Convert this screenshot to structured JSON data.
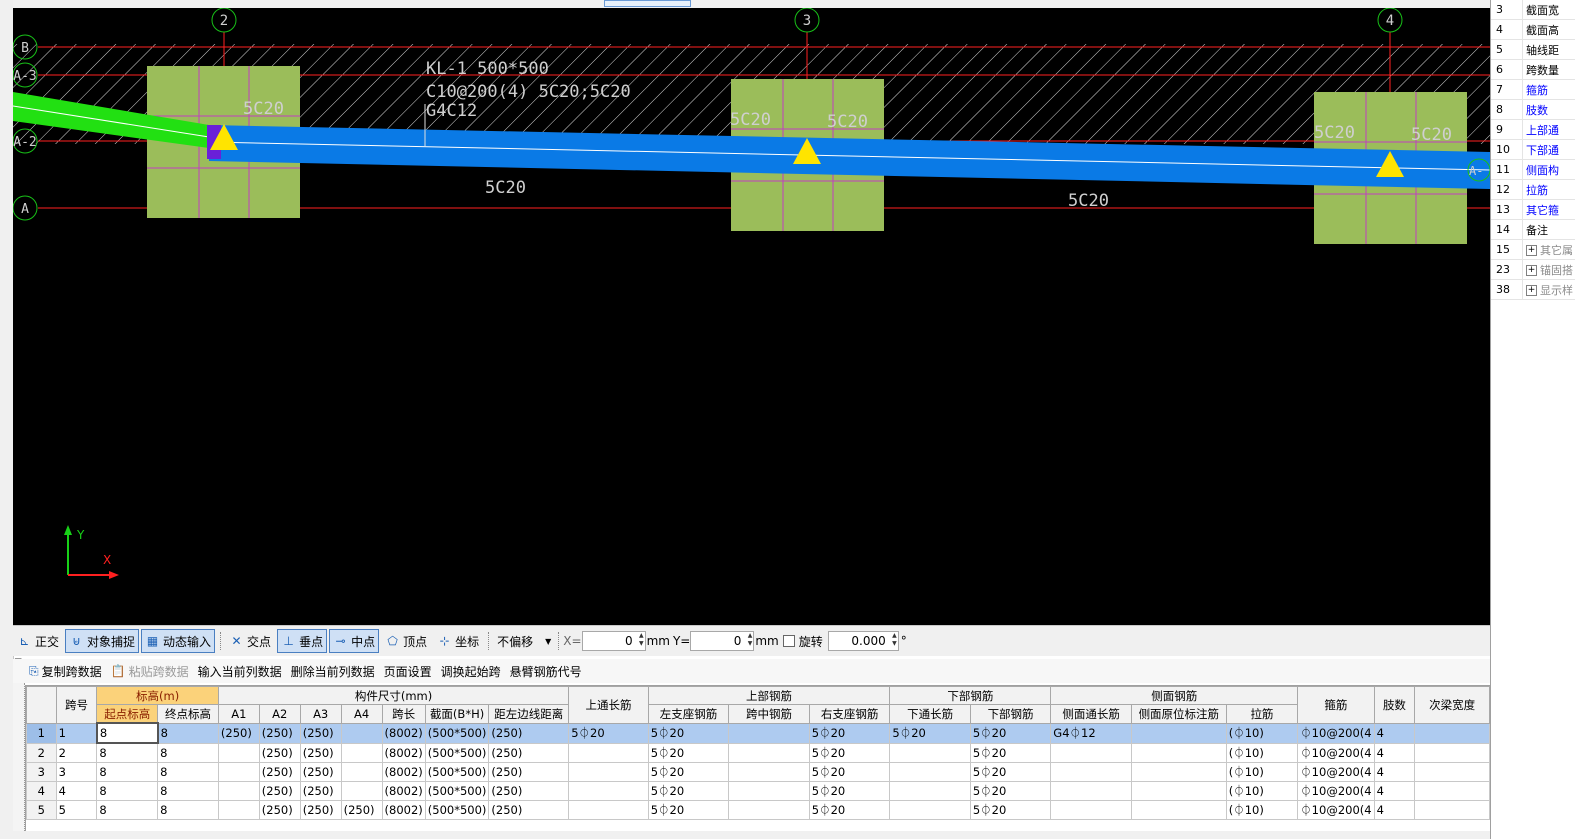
{
  "canvas": {
    "beam_label": [
      "KL-1 500*500",
      "C10@200(4) 5C20;5C20",
      "G4C12"
    ],
    "col_marks": {
      "col2": "5C20",
      "col3_left": "5C20",
      "col3_right": "5C20",
      "col4_left": "5C20",
      "col4_right": "5C20"
    },
    "span_marks": [
      "5C20",
      "5C20"
    ],
    "axis_top": [
      "2",
      "3",
      "4"
    ],
    "axis_left": [
      "B",
      "A-3",
      "A-2",
      "A"
    ],
    "axis_right_partial": "A-",
    "ucs_y": "Y",
    "ucs_x": "X",
    "colors": {
      "blue_beam": "#0a7ae6",
      "green_beam": "#22e012",
      "column": "#9bbd5a",
      "grid_line": "#ff2020",
      "axis_circle": "#18c018",
      "support_triangle": "#ffe400"
    }
  },
  "right_panel": {
    "rows": [
      {
        "num": "3",
        "label": "截面宽",
        "style": "normal"
      },
      {
        "num": "4",
        "label": "截面高",
        "style": "normal"
      },
      {
        "num": "5",
        "label": "轴线距",
        "style": "normal"
      },
      {
        "num": "6",
        "label": "跨数量",
        "style": "normal"
      },
      {
        "num": "7",
        "label": "箍筋",
        "style": "blue"
      },
      {
        "num": "8",
        "label": "肢数",
        "style": "blue"
      },
      {
        "num": "9",
        "label": "上部通",
        "style": "blue"
      },
      {
        "num": "10",
        "label": "下部通",
        "style": "blue"
      },
      {
        "num": "11",
        "label": "侧面构",
        "style": "blue"
      },
      {
        "num": "12",
        "label": "拉筋",
        "style": "blue"
      },
      {
        "num": "13",
        "label": "其它箍",
        "style": "blue"
      },
      {
        "num": "14",
        "label": "备注",
        "style": "normal"
      },
      {
        "num": "15",
        "label": "其它属",
        "style": "gray",
        "plus": "+"
      },
      {
        "num": "23",
        "label": "锚固搭",
        "style": "gray",
        "plus": "+"
      },
      {
        "num": "38",
        "label": "显示样",
        "style": "gray",
        "plus": "+"
      }
    ]
  },
  "snapbar": {
    "ortho": "正交",
    "snap": "对象捕捉",
    "dyn_input": "动态输入",
    "intersection": "交点",
    "perpendicular": "垂点",
    "midpoint": "中点",
    "vertex": "顶点",
    "coordinate": "坐标",
    "offset_mode": "不偏移",
    "x_label": "X=",
    "x_value": "0",
    "x_unit": "mm",
    "y_label": "Y=",
    "y_value": "0",
    "y_unit": "mm",
    "rotate_label": "旋转",
    "rotate_value": "0.000",
    "degree": "°"
  },
  "toolbar2": {
    "copy_span": "复制跨数据",
    "paste_span": "粘贴跨数据",
    "input_col": "输入当前列数据",
    "delete_col": "删除当前列数据",
    "page_setup": "页面设置",
    "swap_start": "调换起始跨",
    "cantilever": "悬臂钢筋代号"
  },
  "grid": {
    "headers": {
      "span_no": "跨号",
      "elevation": "标高(m)",
      "start_elev": "起点标高",
      "end_elev": "终点标高",
      "dims": "构件尺寸(mm)",
      "a1": "A1",
      "a2": "A2",
      "a3": "A3",
      "a4": "A4",
      "span_len": "跨长",
      "section": "截面(B*H)",
      "edge_dist": "距左边线距离",
      "top_through": "上通长筋",
      "top_rebar": "上部钢筋",
      "left_support": "左支座钢筋",
      "mid_span": "跨中钢筋",
      "right_support": "右支座钢筋",
      "bottom_rebar": "下部钢筋",
      "bottom_through": "下通长筋",
      "bottom_steel": "下部钢筋",
      "side_rebar": "侧面钢筋",
      "side_through": "侧面通长筋",
      "side_original": "侧面原位标注筋",
      "tie": "拉筋",
      "stirrup": "箍筋",
      "legs": "肢数",
      "secondary_width": "次梁宽度"
    },
    "rows": [
      {
        "rn": "1",
        "span": "1",
        "start": "8",
        "end": "8",
        "a1": "(250)",
        "a2": "(250)",
        "a3": "(250)",
        "a4": "",
        "len": "(8002)",
        "sec": "(500*500)",
        "edge": "(250)",
        "top_through": "5⏀20",
        "left": "5⏀20",
        "mid": "",
        "right": "5⏀20",
        "bot_through": "5⏀20",
        "bot": "5⏀20",
        "side_through": "G4⏀12",
        "side_orig": "",
        "tie": "(⏀10)",
        "stirrup": "⏀10@200(4",
        "legs": "4",
        "sec_width": ""
      },
      {
        "rn": "2",
        "span": "2",
        "start": "8",
        "end": "8",
        "a1": "",
        "a2": "(250)",
        "a3": "(250)",
        "a4": "",
        "len": "(8002)",
        "sec": "(500*500)",
        "edge": "(250)",
        "top_through": "",
        "left": "5⏀20",
        "mid": "",
        "right": "5⏀20",
        "bot_through": "",
        "bot": "5⏀20",
        "side_through": "",
        "side_orig": "",
        "tie": "(⏀10)",
        "stirrup": "⏀10@200(4",
        "legs": "4",
        "sec_width": ""
      },
      {
        "rn": "3",
        "span": "3",
        "start": "8",
        "end": "8",
        "a1": "",
        "a2": "(250)",
        "a3": "(250)",
        "a4": "",
        "len": "(8002)",
        "sec": "(500*500)",
        "edge": "(250)",
        "top_through": "",
        "left": "5⏀20",
        "mid": "",
        "right": "5⏀20",
        "bot_through": "",
        "bot": "5⏀20",
        "side_through": "",
        "side_orig": "",
        "tie": "(⏀10)",
        "stirrup": "⏀10@200(4",
        "legs": "4",
        "sec_width": ""
      },
      {
        "rn": "4",
        "span": "4",
        "start": "8",
        "end": "8",
        "a1": "",
        "a2": "(250)",
        "a3": "(250)",
        "a4": "",
        "len": "(8002)",
        "sec": "(500*500)",
        "edge": "(250)",
        "top_through": "",
        "left": "5⏀20",
        "mid": "",
        "right": "5⏀20",
        "bot_through": "",
        "bot": "5⏀20",
        "side_through": "",
        "side_orig": "",
        "tie": "(⏀10)",
        "stirrup": "⏀10@200(4",
        "legs": "4",
        "sec_width": ""
      },
      {
        "rn": "5",
        "span": "5",
        "start": "8",
        "end": "8",
        "a1": "",
        "a2": "(250)",
        "a3": "(250)",
        "a4": "(250)",
        "len": "(8002)",
        "sec": "(500*500)",
        "edge": "(250)",
        "top_through": "",
        "left": "5⏀20",
        "mid": "",
        "right": "5⏀20",
        "bot_through": "",
        "bot": "5⏀20",
        "side_through": "",
        "side_orig": "",
        "tie": "(⏀10)",
        "stirrup": "⏀10@200(4",
        "legs": "4",
        "sec_width": ""
      }
    ]
  }
}
